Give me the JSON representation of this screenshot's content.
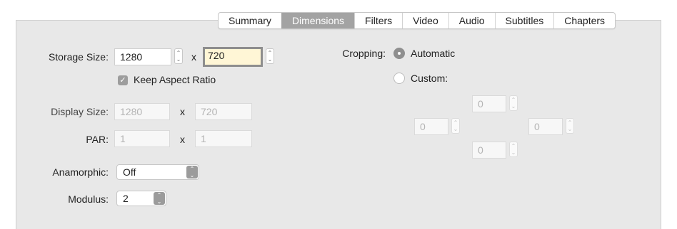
{
  "tabs": [
    "Summary",
    "Dimensions",
    "Filters",
    "Video",
    "Audio",
    "Subtitles",
    "Chapters"
  ],
  "active_tab": "Dimensions",
  "storage": {
    "label": "Storage Size:",
    "width": "1280",
    "height": "720",
    "separator": "x"
  },
  "keep_aspect": {
    "label": "Keep Aspect Ratio",
    "checked": true
  },
  "display": {
    "label": "Display Size:",
    "width": "1280",
    "height": "720",
    "separator": "x"
  },
  "par": {
    "label": "PAR:",
    "width": "1",
    "height": "1",
    "separator": "x"
  },
  "anamorphic": {
    "label": "Anamorphic:",
    "value": "Off"
  },
  "modulus": {
    "label": "Modulus:",
    "value": "2"
  },
  "cropping": {
    "label": "Cropping:",
    "automatic_label": "Automatic",
    "custom_label": "Custom:",
    "selected": "Automatic",
    "top": "0",
    "left": "0",
    "right": "0",
    "bottom": "0"
  }
}
